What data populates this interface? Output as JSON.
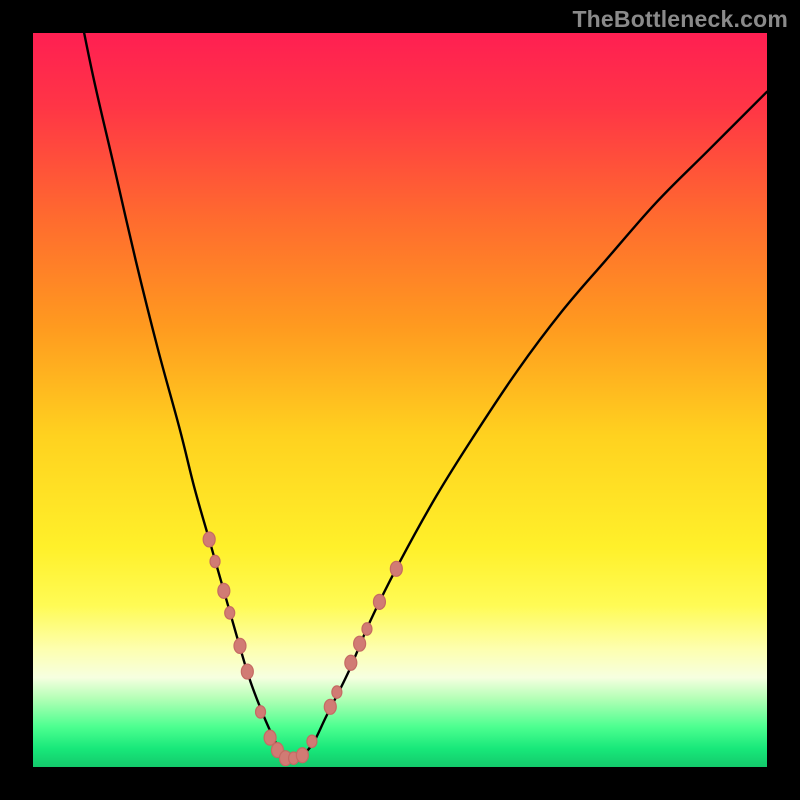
{
  "watermark": "TheBottleneck.com",
  "gradient_stops": [
    {
      "offset": 0.0,
      "color": "#ff1f52"
    },
    {
      "offset": 0.1,
      "color": "#ff3546"
    },
    {
      "offset": 0.25,
      "color": "#ff6a2f"
    },
    {
      "offset": 0.4,
      "color": "#ff9a1f"
    },
    {
      "offset": 0.55,
      "color": "#ffd21f"
    },
    {
      "offset": 0.7,
      "color": "#fff02a"
    },
    {
      "offset": 0.78,
      "color": "#fffb55"
    },
    {
      "offset": 0.84,
      "color": "#fdffb0"
    },
    {
      "offset": 0.878,
      "color": "#f6ffe0"
    },
    {
      "offset": 0.905,
      "color": "#b8ffb8"
    },
    {
      "offset": 0.945,
      "color": "#4dff90"
    },
    {
      "offset": 0.975,
      "color": "#18e87a"
    },
    {
      "offset": 1.0,
      "color": "#13c96b"
    }
  ],
  "chart_data": {
    "type": "line",
    "title": "",
    "xlabel": "",
    "ylabel": "",
    "xlim": [
      0,
      100
    ],
    "ylim": [
      0,
      100
    ],
    "series": [
      {
        "name": "bottleneck-curve",
        "x": [
          5,
          8,
          11,
          14,
          17,
          20,
          22,
          24,
          26,
          28,
          29.5,
          31,
          32.5,
          33.5,
          34.5,
          36,
          38,
          40,
          43,
          46,
          50,
          55,
          60,
          66,
          72,
          78,
          85,
          92,
          100
        ],
        "y": [
          110,
          95,
          82,
          69,
          57,
          46,
          38,
          31,
          24,
          17,
          12,
          8,
          4.5,
          2.5,
          1.2,
          1.2,
          3,
          7,
          13,
          20,
          28,
          37,
          45,
          54,
          62,
          69,
          77,
          84,
          92
        ]
      }
    ],
    "marker_points": {
      "name": "sample-dots",
      "points": [
        {
          "x": 24.0,
          "y": 31,
          "r": 6
        },
        {
          "x": 24.8,
          "y": 28,
          "r": 5
        },
        {
          "x": 26.0,
          "y": 24,
          "r": 6
        },
        {
          "x": 26.8,
          "y": 21,
          "r": 5
        },
        {
          "x": 28.2,
          "y": 16.5,
          "r": 6
        },
        {
          "x": 29.2,
          "y": 13,
          "r": 6
        },
        {
          "x": 31.0,
          "y": 7.5,
          "r": 5
        },
        {
          "x": 32.3,
          "y": 4.0,
          "r": 6
        },
        {
          "x": 33.3,
          "y": 2.3,
          "r": 6
        },
        {
          "x": 34.4,
          "y": 1.2,
          "r": 6
        },
        {
          "x": 35.5,
          "y": 1.2,
          "r": 5
        },
        {
          "x": 36.7,
          "y": 1.6,
          "r": 6
        },
        {
          "x": 38.0,
          "y": 3.5,
          "r": 5
        },
        {
          "x": 40.5,
          "y": 8.2,
          "r": 6
        },
        {
          "x": 41.4,
          "y": 10.2,
          "r": 5
        },
        {
          "x": 43.3,
          "y": 14.2,
          "r": 6
        },
        {
          "x": 44.5,
          "y": 16.8,
          "r": 6
        },
        {
          "x": 45.5,
          "y": 18.8,
          "r": 5
        },
        {
          "x": 47.2,
          "y": 22.5,
          "r": 6
        },
        {
          "x": 49.5,
          "y": 27.0,
          "r": 6
        }
      ]
    }
  }
}
